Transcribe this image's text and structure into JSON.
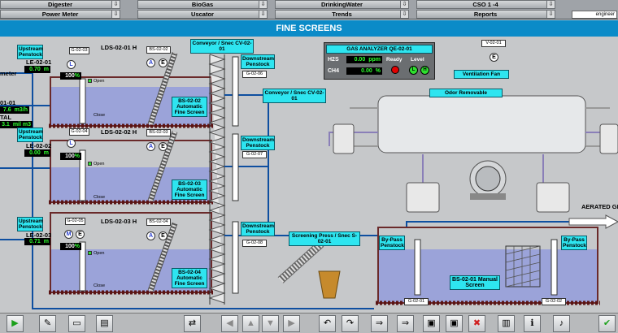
{
  "nav": {
    "row1": [
      "Digester",
      "BioGas",
      "DrinkingWater",
      "CSO 1 -4"
    ],
    "row2": [
      "Power Meter",
      "Uscator",
      "Trends",
      "Reports"
    ],
    "user": "engineer"
  },
  "title": "FINE SCREENS",
  "labels": {
    "conveyor_top": "Conveyor / Snec CV-02-01",
    "conveyor_right": "Conveyor / Snec CV-02-01",
    "screening_press": "Screening Press / Snec S-02-01",
    "odor_removable": "Odor Removable",
    "ventilation_fan": "Ventilation Fan",
    "aerated": "AERATED GR",
    "meter_partial": "meter",
    "flow_id_partial": "01-01",
    "flow_val_partial": "7.6",
    "flow_unit": "m3/h",
    "total_partial": "TAL",
    "total_val_partial": "3.1",
    "total_unit": "mil m3",
    "open": "Open",
    "close": "Close",
    "fan_tag": "V-02-01"
  },
  "gas_analyzer": {
    "title": "GAS ANALYZER QE-02-01",
    "h2s_label": "H2S",
    "h2s_value": "0.00",
    "h2s_unit": "ppm",
    "ch4_label": "CH4",
    "ch4_value": "0.00",
    "ch4_unit": "%",
    "ready": "Ready",
    "level": "Level",
    "l": "L",
    "h": "H"
  },
  "channels": [
    {
      "upstream": "Upstream Penstock",
      "le": "LE-02-01",
      "le_value": "0.70",
      "le_unit": "m",
      "mode": "L",
      "gate_tag": "G-02-03",
      "pct": "100",
      "pct_unit": "%",
      "lds": "LDS-02-01 H",
      "bs_tag": "BS-02-02",
      "mode2": "A",
      "screen_name": "BS-02-02 Automatic Fine Screen",
      "downstream": "Downstream Penstock",
      "down_tag": "G-02-06"
    },
    {
      "upstream": "Upstream Penstock",
      "le": "LE-02-02",
      "le_value": "0.00",
      "le_unit": "m",
      "mode": "L",
      "gate_tag": "G-02-04",
      "pct": "100",
      "pct_unit": "%",
      "lds": "LDS-02-02 H",
      "bs_tag": "BS-02-03",
      "mode2": "A",
      "screen_name": "BS-02-03 Automatic Fine Screen",
      "downstream": "Downstream Penstock",
      "down_tag": "G-02-07"
    },
    {
      "upstream": "Upstream Penstock",
      "le": "LE-02-03",
      "le_value": "0.71",
      "le_unit": "m",
      "mode": "M",
      "gate_tag": "G-02-05",
      "pct": "100",
      "pct_unit": "%",
      "lds": "LDS-02-03 H",
      "bs_tag": "BS-02-04",
      "mode2": "A",
      "screen_name": "BS-02-04 Automatic Fine Screen",
      "downstream": "Downstream Penstock",
      "down_tag": "G-02-08"
    }
  ],
  "bypass": {
    "left": "By-Pass Penstock",
    "right": "By-Pass Penstock",
    "screen_name": "BS-02-01 Manual Screen",
    "left_tag": "G-02-01",
    "right_tag": "G-02-02"
  },
  "toolbar": [
    {
      "name": "play",
      "glyph": "▶"
    },
    {
      "name": "tools",
      "glyph": "✎"
    },
    {
      "name": "folder",
      "glyph": "▭"
    },
    {
      "name": "document",
      "glyph": "▤"
    },
    {
      "name": "transfer",
      "glyph": "⇄"
    },
    {
      "name": "nav-left",
      "glyph": "◀"
    },
    {
      "name": "nav-up",
      "glyph": "▲"
    },
    {
      "name": "nav-down",
      "glyph": "▼"
    },
    {
      "name": "nav-right",
      "glyph": "▶"
    },
    {
      "name": "undo",
      "glyph": "↶"
    },
    {
      "name": "redo",
      "glyph": "↷"
    },
    {
      "name": "import",
      "glyph": "⇒"
    },
    {
      "name": "export",
      "glyph": "⇒"
    },
    {
      "name": "save",
      "glyph": "▣"
    },
    {
      "name": "save-as",
      "glyph": "▣"
    },
    {
      "name": "delete",
      "glyph": "✖"
    },
    {
      "name": "print",
      "glyph": "▥"
    },
    {
      "name": "info",
      "glyph": "ℹ"
    },
    {
      "name": "sound",
      "glyph": "♪"
    },
    {
      "name": "confirm",
      "glyph": "✔"
    }
  ]
}
